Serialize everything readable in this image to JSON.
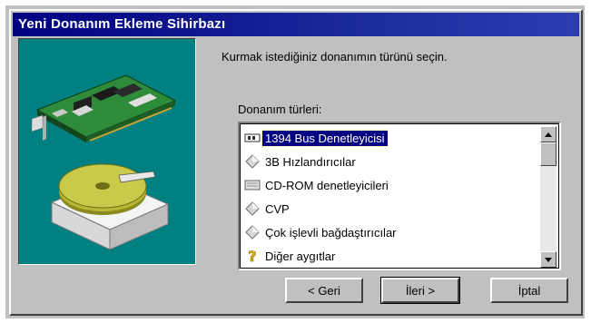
{
  "window": {
    "title": "Yeni Donanım Ekleme Sihirbazı"
  },
  "illustration": {
    "background": "#008080",
    "items": [
      "expansion-card",
      "hard-disk"
    ]
  },
  "instruction": "Kurmak istediğiniz donanımın türünü seçin.",
  "list": {
    "label": "Donanım türleri:",
    "items": [
      {
        "label": "1394 Bus Denetleyicisi",
        "icon": "1394-bus-icon",
        "selected": true
      },
      {
        "label": "3B Hızlandırıcılar",
        "icon": "diamond-icon",
        "selected": false
      },
      {
        "label": "CD-ROM denetleyicileri",
        "icon": "cdrom-controller-icon",
        "selected": false
      },
      {
        "label": "CVP",
        "icon": "diamond-icon",
        "selected": false
      },
      {
        "label": "Çok işlevli bağdaştırıcılar",
        "icon": "diamond-icon",
        "selected": false
      },
      {
        "label": "Diğer aygıtlar",
        "icon": "question-icon",
        "selected": false
      }
    ]
  },
  "buttons": {
    "back": "< Geri",
    "next": "İleri >",
    "cancel": "İptal"
  },
  "colors": {
    "selection": "#000080",
    "titlebar": "#000080",
    "face": "#c0c0c0"
  }
}
